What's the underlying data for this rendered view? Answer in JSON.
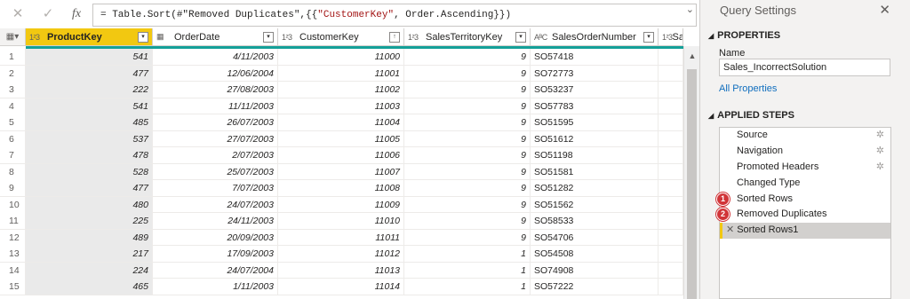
{
  "formula_bar": {
    "cancel_icon": "✕",
    "confirm_icon": "✓",
    "fx_label": "fx",
    "formula_prefix": "= Table.Sort(#\"Removed Duplicates\",{{",
    "formula_string": "\"CustomerKey\"",
    "formula_suffix": ", Order.Ascending}})",
    "expand_icon": "⌄"
  },
  "grid": {
    "corner_icon": "▦▾",
    "columns": [
      {
        "type_icon": "1²3",
        "name": "ProductKey",
        "filter_icon": "▾"
      },
      {
        "type_icon": "▦",
        "name": "OrderDate",
        "filter_icon": "▾"
      },
      {
        "type_icon": "1²3",
        "name": "CustomerKey",
        "filter_icon": "↑"
      },
      {
        "type_icon": "1²3",
        "name": "SalesTerritoryKey",
        "filter_icon": "▾"
      },
      {
        "type_icon": "AᴮC",
        "name": "SalesOrderNumber",
        "filter_icon": "▾"
      },
      {
        "type_icon": "1²3",
        "name": "Sales",
        "filter_icon": ""
      }
    ],
    "rows": [
      [
        "1",
        "541",
        "4/11/2003",
        "11000",
        "9",
        "SO57418"
      ],
      [
        "2",
        "477",
        "12/06/2004",
        "11001",
        "9",
        "SO72773"
      ],
      [
        "3",
        "222",
        "27/08/2003",
        "11002",
        "9",
        "SO53237"
      ],
      [
        "4",
        "541",
        "11/11/2003",
        "11003",
        "9",
        "SO57783"
      ],
      [
        "5",
        "485",
        "26/07/2003",
        "11004",
        "9",
        "SO51595"
      ],
      [
        "6",
        "537",
        "27/07/2003",
        "11005",
        "9",
        "SO51612"
      ],
      [
        "7",
        "478",
        "2/07/2003",
        "11006",
        "9",
        "SO51198"
      ],
      [
        "8",
        "528",
        "25/07/2003",
        "11007",
        "9",
        "SO51581"
      ],
      [
        "9",
        "477",
        "7/07/2003",
        "11008",
        "9",
        "SO51282"
      ],
      [
        "10",
        "480",
        "24/07/2003",
        "11009",
        "9",
        "SO51562"
      ],
      [
        "11",
        "225",
        "24/11/2003",
        "11010",
        "9",
        "SO58533"
      ],
      [
        "12",
        "489",
        "20/09/2003",
        "11011",
        "9",
        "SO54706"
      ],
      [
        "13",
        "217",
        "17/09/2003",
        "11012",
        "1",
        "SO54508"
      ],
      [
        "14",
        "224",
        "24/07/2004",
        "11013",
        "1",
        "SO74908"
      ],
      [
        "15",
        "465",
        "1/11/2003",
        "11014",
        "1",
        "SO57222"
      ]
    ],
    "scroll_up_icon": "▲"
  },
  "query_settings": {
    "title": "Query Settings",
    "close_icon": "✕",
    "properties_heading": "PROPERTIES",
    "name_label": "Name",
    "name_value": "Sales_IncorrectSolution",
    "all_properties_link": "All Properties",
    "applied_steps_heading": "APPLIED STEPS",
    "section_toggle_icon": "◢",
    "steps": [
      {
        "label": "Source",
        "gear": "✲",
        "badge": ""
      },
      {
        "label": "Navigation",
        "gear": "✲",
        "badge": ""
      },
      {
        "label": "Promoted Headers",
        "gear": "✲",
        "badge": ""
      },
      {
        "label": "Changed Type",
        "gear": "",
        "badge": ""
      },
      {
        "label": "Sorted Rows",
        "gear": "",
        "badge": "1"
      },
      {
        "label": "Removed Duplicates",
        "gear": "",
        "badge": "2"
      },
      {
        "label": "Sorted Rows1",
        "gear": "",
        "badge": "",
        "delete_icon": "✕"
      }
    ]
  },
  "colors": {
    "selected_column": "#f2c811",
    "teal_quality_bar": "#14a098",
    "badge_red": "#d13438",
    "link_blue": "#106ebe"
  }
}
